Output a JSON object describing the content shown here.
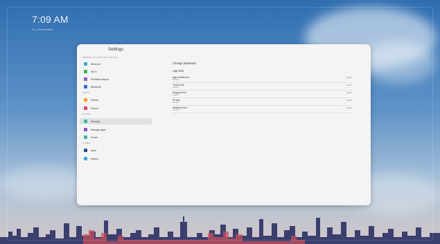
{
  "desktop": {
    "time": "7:09 AM",
    "date": "Fri, 25 November"
  },
  "settings": {
    "title": "Settings",
    "sidebar": {
      "sections": [
        {
          "title": "Network & connectivity devices",
          "items": [
            {
              "label": "Ethernet",
              "color": "#33a6d6",
              "icon": "ethernet-icon"
            },
            {
              "label": "Wi-Fi",
              "color": "#3fb554",
              "icon": "wifi-icon"
            },
            {
              "label": "Portable hotspot",
              "color": "#8b5ac9",
              "icon": "hotspot-icon"
            },
            {
              "label": "Bluetooth",
              "color": "#2f6ad6",
              "icon": "bluetooth-icon"
            }
          ]
        },
        {
          "title": "Device",
          "items": [
            {
              "label": "Picture",
              "color": "#f0a020",
              "icon": "picture-icon"
            },
            {
              "label": "Sound",
              "color": "#e5396b",
              "icon": "sound-icon"
            }
          ]
        },
        {
          "title": "System",
          "items": [
            {
              "label": "Security",
              "color": "#2fb8a6",
              "icon": "shield-icon",
              "active": true
            },
            {
              "label": "Manage apps",
              "color": "#7a55d0",
              "icon": "apps-icon"
            },
            {
              "label": "Power",
              "color": "#2fb8a6",
              "icon": "power-icon"
            }
          ]
        },
        {
          "title": "Others",
          "items": [
            {
              "label": "More",
              "color": "#2f4f8f",
              "icon": "more-icon"
            },
            {
              "label": "Device",
              "color": "#33a6d6",
              "icon": "device-icon"
            }
          ]
        }
      ]
    },
    "content": {
      "change_password": "Change password",
      "app_lock": "App lock",
      "toggle_state": "Off",
      "rows": [
        {
          "label": "App install lock",
          "status": "Disabled"
        },
        {
          "label": "Touch lock",
          "status": "Disabled"
        },
        {
          "label": "Keypad lock",
          "status": "Disabled"
        },
        {
          "label": "IR lock",
          "status": "Disabled"
        },
        {
          "label": "Network lock",
          "status": "Disabled"
        }
      ]
    }
  }
}
